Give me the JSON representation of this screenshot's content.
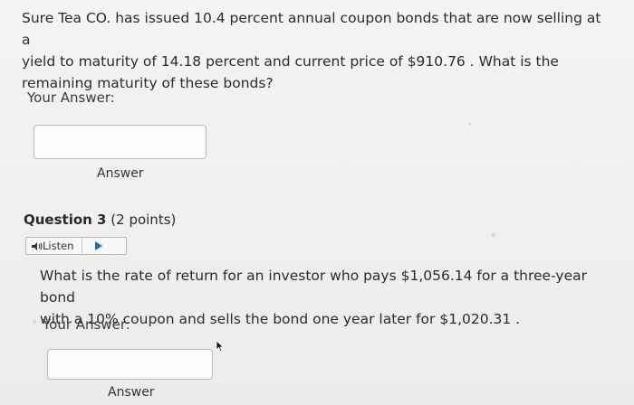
{
  "question_prev": {
    "text_lines": [
      "Sure Tea CO. has issued 10.4 percent annual coupon bonds that are now selling at a",
      "yield to maturity of 14.18 percent and current price of $910.76 . What is the",
      "remaining maturity of these bonds?"
    ],
    "your_answer_label": "Your Answer:",
    "answer_caption": "Answer"
  },
  "question3": {
    "title": "Question 3",
    "points": "(2 points)",
    "listen_label": "Listen",
    "text_lines": [
      "What is the rate of return for an investor who pays $1,056.14 for a three-year bond",
      "with a 10% coupon and sells the bond one year later for $1,020.31 ."
    ],
    "your_answer_label": "Your Answer:",
    "answer_caption": "Answer"
  },
  "icons": {
    "speaker": "speaker-icon",
    "play": "play-icon",
    "cursor": "cursor-icon"
  },
  "colors": {
    "play_accent": "#1e6fb5"
  }
}
